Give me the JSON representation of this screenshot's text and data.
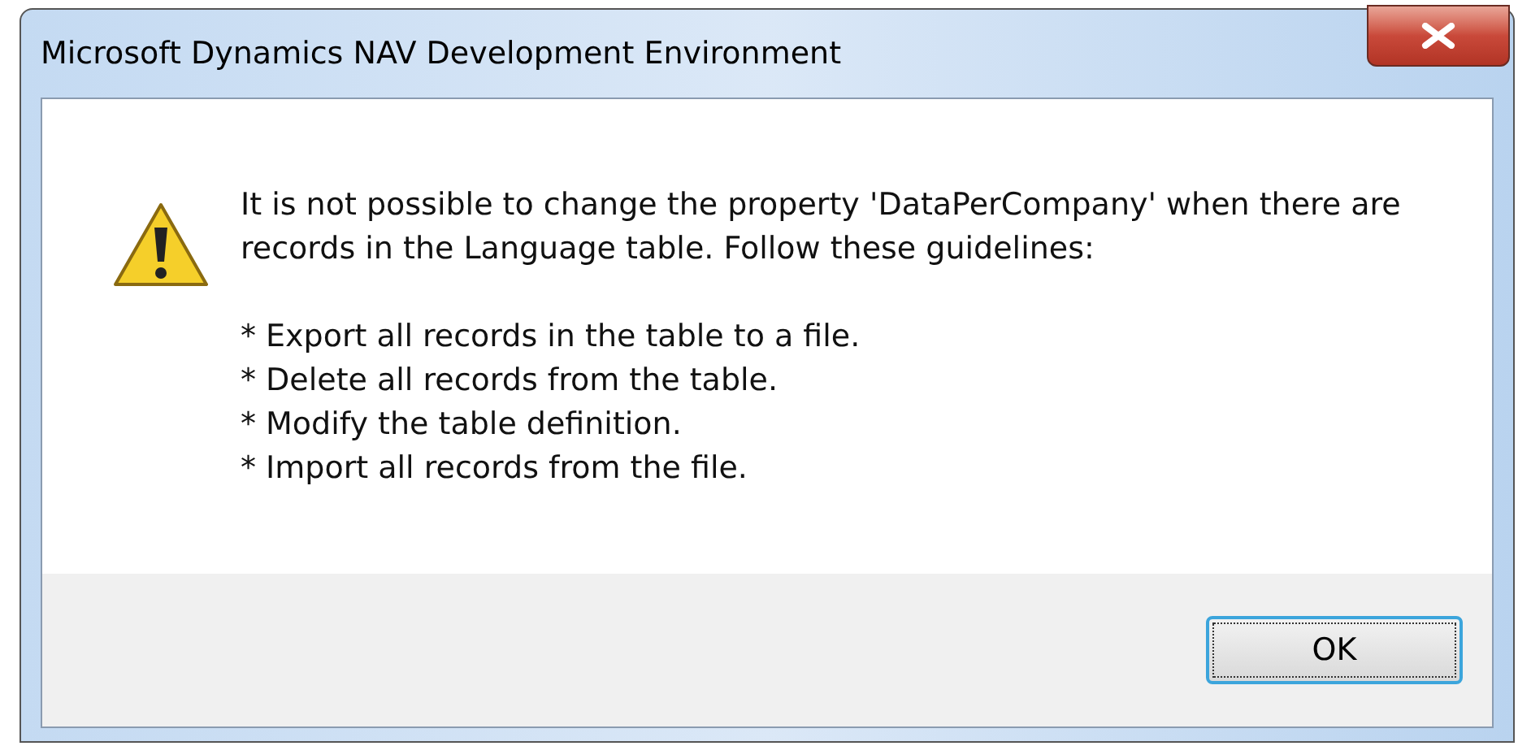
{
  "window": {
    "title": "Microsoft Dynamics NAV Development Environment"
  },
  "message": {
    "text": "It is not possible to change the property 'DataPerCompany' when there are records in the Language table. Follow these guidelines:",
    "steps": [
      "* Export all records in the table to a file.",
      "* Delete all records from the table.",
      "* Modify the table definition.",
      "* Import all records from the file."
    ]
  },
  "buttons": [
    {
      "label": "OK",
      "selected": true
    }
  ]
}
